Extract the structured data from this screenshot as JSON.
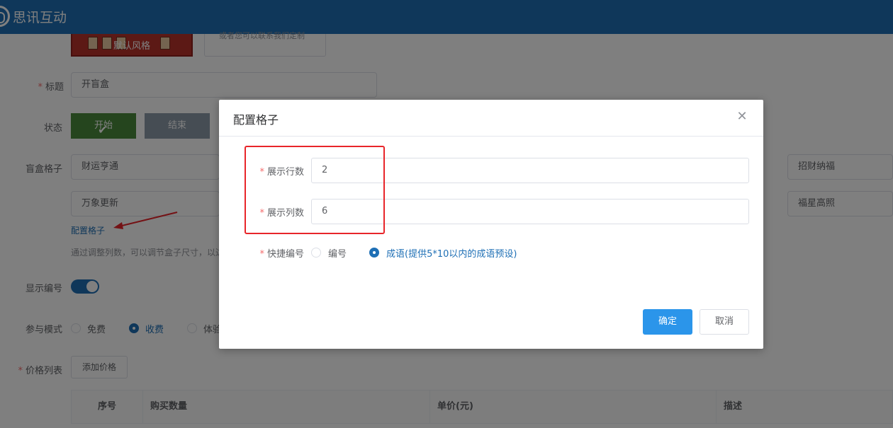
{
  "header": {
    "brand": "思讯互动"
  },
  "form": {
    "style_thumb_label": "默认风格",
    "style_note": "或者您可以联系我们定制",
    "title_label": "标题",
    "title_value": "开盲盒",
    "status_label": "状态",
    "status_start": "开始",
    "status_end": "结束",
    "grid_label": "盲盒格子",
    "grid_cells": [
      "财运亨通",
      "招财纳福",
      "万象更新",
      "福星高照"
    ],
    "config_link": "配置格子",
    "hint": "通过调整列数，可以调节盒子尺寸，以达",
    "show_number_label": "显示编号",
    "mode_label": "参与模式",
    "mode_options": [
      "免费",
      "收费",
      "体验"
    ],
    "price_label": "价格列表",
    "add_price_button": "添加价格",
    "table_headers": [
      "序号",
      "购买数量",
      "单价(元)",
      "描述"
    ]
  },
  "dialog": {
    "title": "配置格子",
    "rows_label": "展示行数",
    "rows_value": "2",
    "cols_label": "展示列数",
    "cols_value": "6",
    "numbering_label": "快捷编号",
    "numbering_options": [
      "编号",
      "成语(提供5*10以内的成语预设)"
    ],
    "confirm": "确定",
    "cancel": "取消"
  },
  "colors": {
    "header": "#1e6fb5",
    "primary": "#2b95ea",
    "highlight": "#e8252a"
  }
}
